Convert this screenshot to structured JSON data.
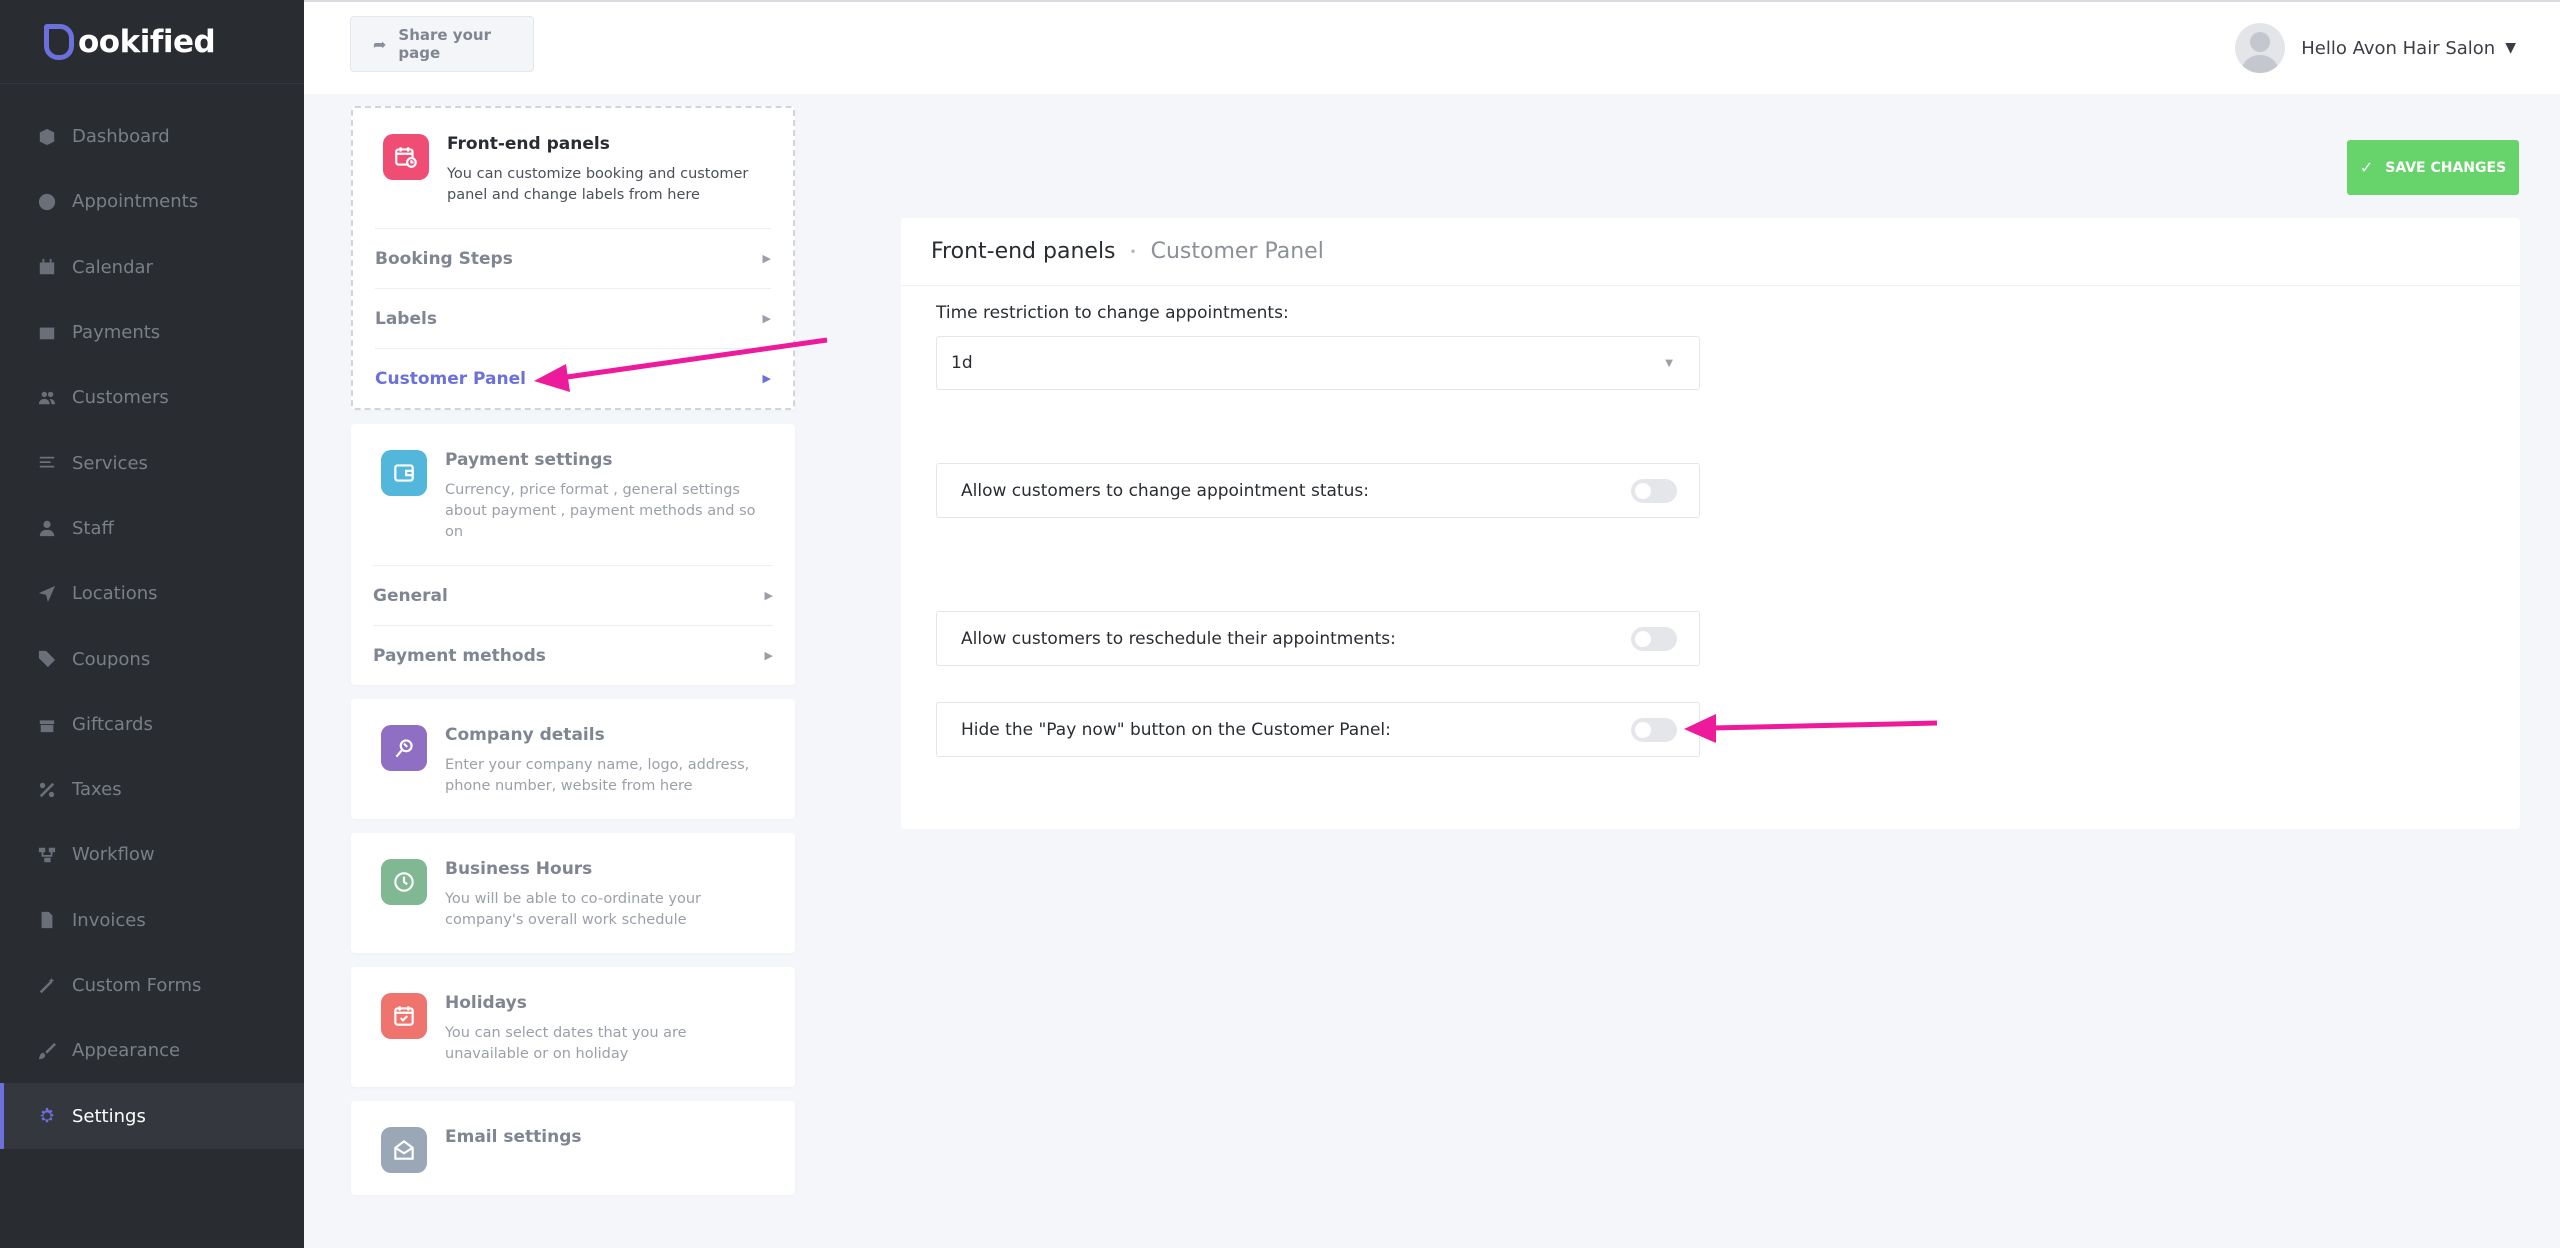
{
  "brand": {
    "logo_text": "ookified",
    "accent": "#6c70dc"
  },
  "sidebar": {
    "items": [
      {
        "label": "Dashboard",
        "icon": "cube-icon",
        "active": false
      },
      {
        "label": "Appointments",
        "icon": "clock-icon",
        "active": false
      },
      {
        "label": "Calendar",
        "icon": "calendar-icon",
        "active": false
      },
      {
        "label": "Payments",
        "icon": "wallet-icon",
        "active": false
      },
      {
        "label": "Customers",
        "icon": "users-icon",
        "active": false
      },
      {
        "label": "Services",
        "icon": "list-icon",
        "active": false
      },
      {
        "label": "Staff",
        "icon": "user-icon",
        "active": false
      },
      {
        "label": "Locations",
        "icon": "location-arrow-icon",
        "active": false
      },
      {
        "label": "Coupons",
        "icon": "tag-icon",
        "active": false
      },
      {
        "label": "Giftcards",
        "icon": "gift-icon",
        "active": false
      },
      {
        "label": "Taxes",
        "icon": "percent-icon",
        "active": false
      },
      {
        "label": "Workflow",
        "icon": "workflow-icon",
        "active": false
      },
      {
        "label": "Invoices",
        "icon": "file-icon",
        "active": false
      },
      {
        "label": "Custom Forms",
        "icon": "magic-icon",
        "active": false
      },
      {
        "label": "Appearance",
        "icon": "brush-icon",
        "active": false
      },
      {
        "label": "Settings",
        "icon": "gear-icon",
        "active": true
      }
    ]
  },
  "header": {
    "share_label": "Share your page",
    "user_greeting": "Hello Avon Hair Salon"
  },
  "settings_cards": [
    {
      "title": "Front-end panels",
      "desc": "You can customize booking and customer panel and change labels from here",
      "icon": "calendar-clock-icon",
      "color": "#ef4d73",
      "subitems": [
        {
          "label": "Booking Steps",
          "active": false
        },
        {
          "label": "Labels",
          "active": false
        },
        {
          "label": "Customer Panel",
          "active": true
        }
      ]
    },
    {
      "title": "Payment settings",
      "desc": "Currency, price format , general settings about payment , payment methods and so on",
      "icon": "wallet-icon",
      "color": "#53b7dc",
      "subitems": [
        {
          "label": "General",
          "active": false
        },
        {
          "label": "Payment methods",
          "active": false
        }
      ]
    },
    {
      "title": "Company details",
      "desc": "Enter your company name, logo, address, phone number, website from here",
      "icon": "company-icon",
      "color": "#8f6fc4"
    },
    {
      "title": "Business Hours",
      "desc": "You will be able to co-ordinate your company's overall work schedule",
      "icon": "clock-icon",
      "color": "#7fb893"
    },
    {
      "title": "Holidays",
      "desc": "You can select dates that you are unavailable or on holiday",
      "icon": "calendar-check-icon",
      "color": "#f0746e"
    },
    {
      "title": "Email settings",
      "desc": "",
      "icon": "envelope-icon",
      "color": "#9aa7b6"
    }
  ],
  "save_button": {
    "label": "SAVE CHANGES",
    "color": "#66d46a"
  },
  "panel": {
    "crumb_parent": "Front-end panels",
    "crumb_current": "Customer Panel",
    "time_restriction_label": "Time restriction to change appointments:",
    "time_restriction_value": "1d",
    "toggles": [
      {
        "label": "Allow customers to change appointment status:",
        "on": false
      },
      {
        "label": "Allow customers to reschedule their appointments:",
        "on": false
      },
      {
        "label": "Hide the \"Pay now\" button on the Customer Panel:",
        "on": false
      }
    ]
  },
  "annotation_color": "#ee1a9c"
}
